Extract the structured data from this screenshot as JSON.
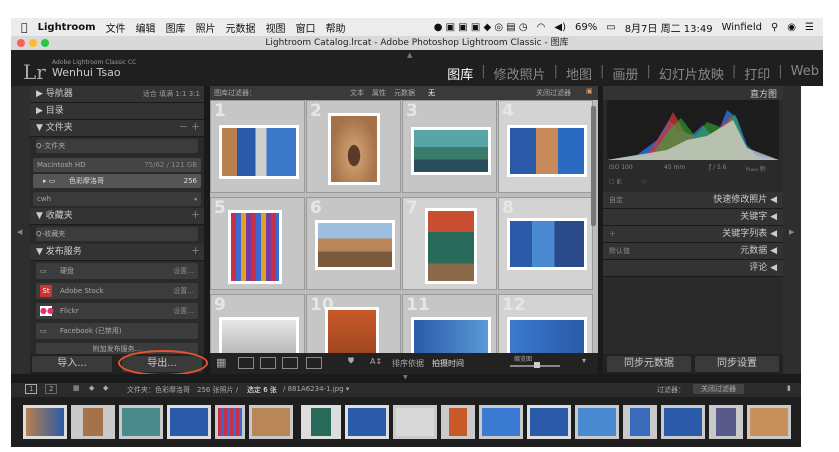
{
  "menubar": {
    "apple": "",
    "items": [
      "Lightroom",
      "文件",
      "编辑",
      "图库",
      "照片",
      "元数据",
      "视图",
      "窗口",
      "帮助"
    ],
    "battery": "69%",
    "datetime": "8月7日 周二 13:49",
    "user": "Winfield"
  },
  "window": {
    "title": "Lightroom Catalog.lrcat - Adobe Photoshop Lightroom Classic - 图库"
  },
  "identity": {
    "logo": "Lr",
    "brand": "Adobe Lightroom Classic CC",
    "user": "Wenhui Tsao"
  },
  "modules": [
    "图库",
    "修改照片",
    "地图",
    "画册",
    "幻灯片放映",
    "打印",
    "Web"
  ],
  "left_panel": {
    "navigator": {
      "label": "导航器",
      "opts": "适合  填满  1:1  3:1"
    },
    "catalog": {
      "label": "目录"
    },
    "folders": {
      "label": "文件夹",
      "add": "－ ＋",
      "filter_placeholder": "Q-文件夹",
      "volume": "Macintosh HD",
      "volume_info": "75/62 / 121 GB",
      "folder": "色彩摩洛哥",
      "folder_count": "256",
      "cwh": "cwh"
    },
    "collections": {
      "label": "收藏夹",
      "add": "＋",
      "filter_placeholder": "Q-收藏夹"
    },
    "publish": {
      "label": "发布服务",
      "add": "＋",
      "items": [
        "硬盘",
        "Adobe Stock",
        "Flickr",
        "Facebook (已禁用)"
      ],
      "setup": "设置...",
      "more": "附加发布服务..."
    },
    "import_btn": "导入...",
    "export_btn": "导出..."
  },
  "filter_bar": {
    "label": "图库过滤器：",
    "text": "文本",
    "attr": "属性",
    "meta": "元数据",
    "none": "无",
    "off": "关闭过滤器"
  },
  "grid": {
    "numbers": [
      "1",
      "2",
      "3",
      "4",
      "5",
      "6",
      "7",
      "8",
      "9",
      "10",
      "11",
      "12"
    ]
  },
  "grid_toolbar": {
    "sort_label": "排序依据",
    "sort_value": "拍摄时间",
    "thumb_label": "缩览图"
  },
  "right_panel": {
    "histogram": "直方图",
    "iso": "ISO 100",
    "focal": "45 mm",
    "aperture": "ƒ / 5.6",
    "shutter": "¹⁄₁₆₀₀ 秒",
    "preset_label": "自定",
    "quick": "快速修改照片",
    "keywords": "关键字",
    "keyword_list": "关键字列表",
    "metadata_preset": "默认值",
    "metadata": "元数据",
    "comments": "评论",
    "sync_meta": "同步元数据",
    "sync_settings": "同步设置"
  },
  "filmstrip_bar": {
    "views": [
      "1",
      "2"
    ],
    "path": "文件夹：色彩摩洛哥",
    "count": "256 张照片 /",
    "selected": "选定 6 张",
    "file": "/ 881A6234-1.jpg ▾",
    "filter_label": "过滤器：",
    "filter_value": "关闭过滤器"
  },
  "colors": {
    "accent_ring": "#e8542d",
    "panel": "#2a2a2a",
    "grid_bg": "#bcbcbc"
  }
}
